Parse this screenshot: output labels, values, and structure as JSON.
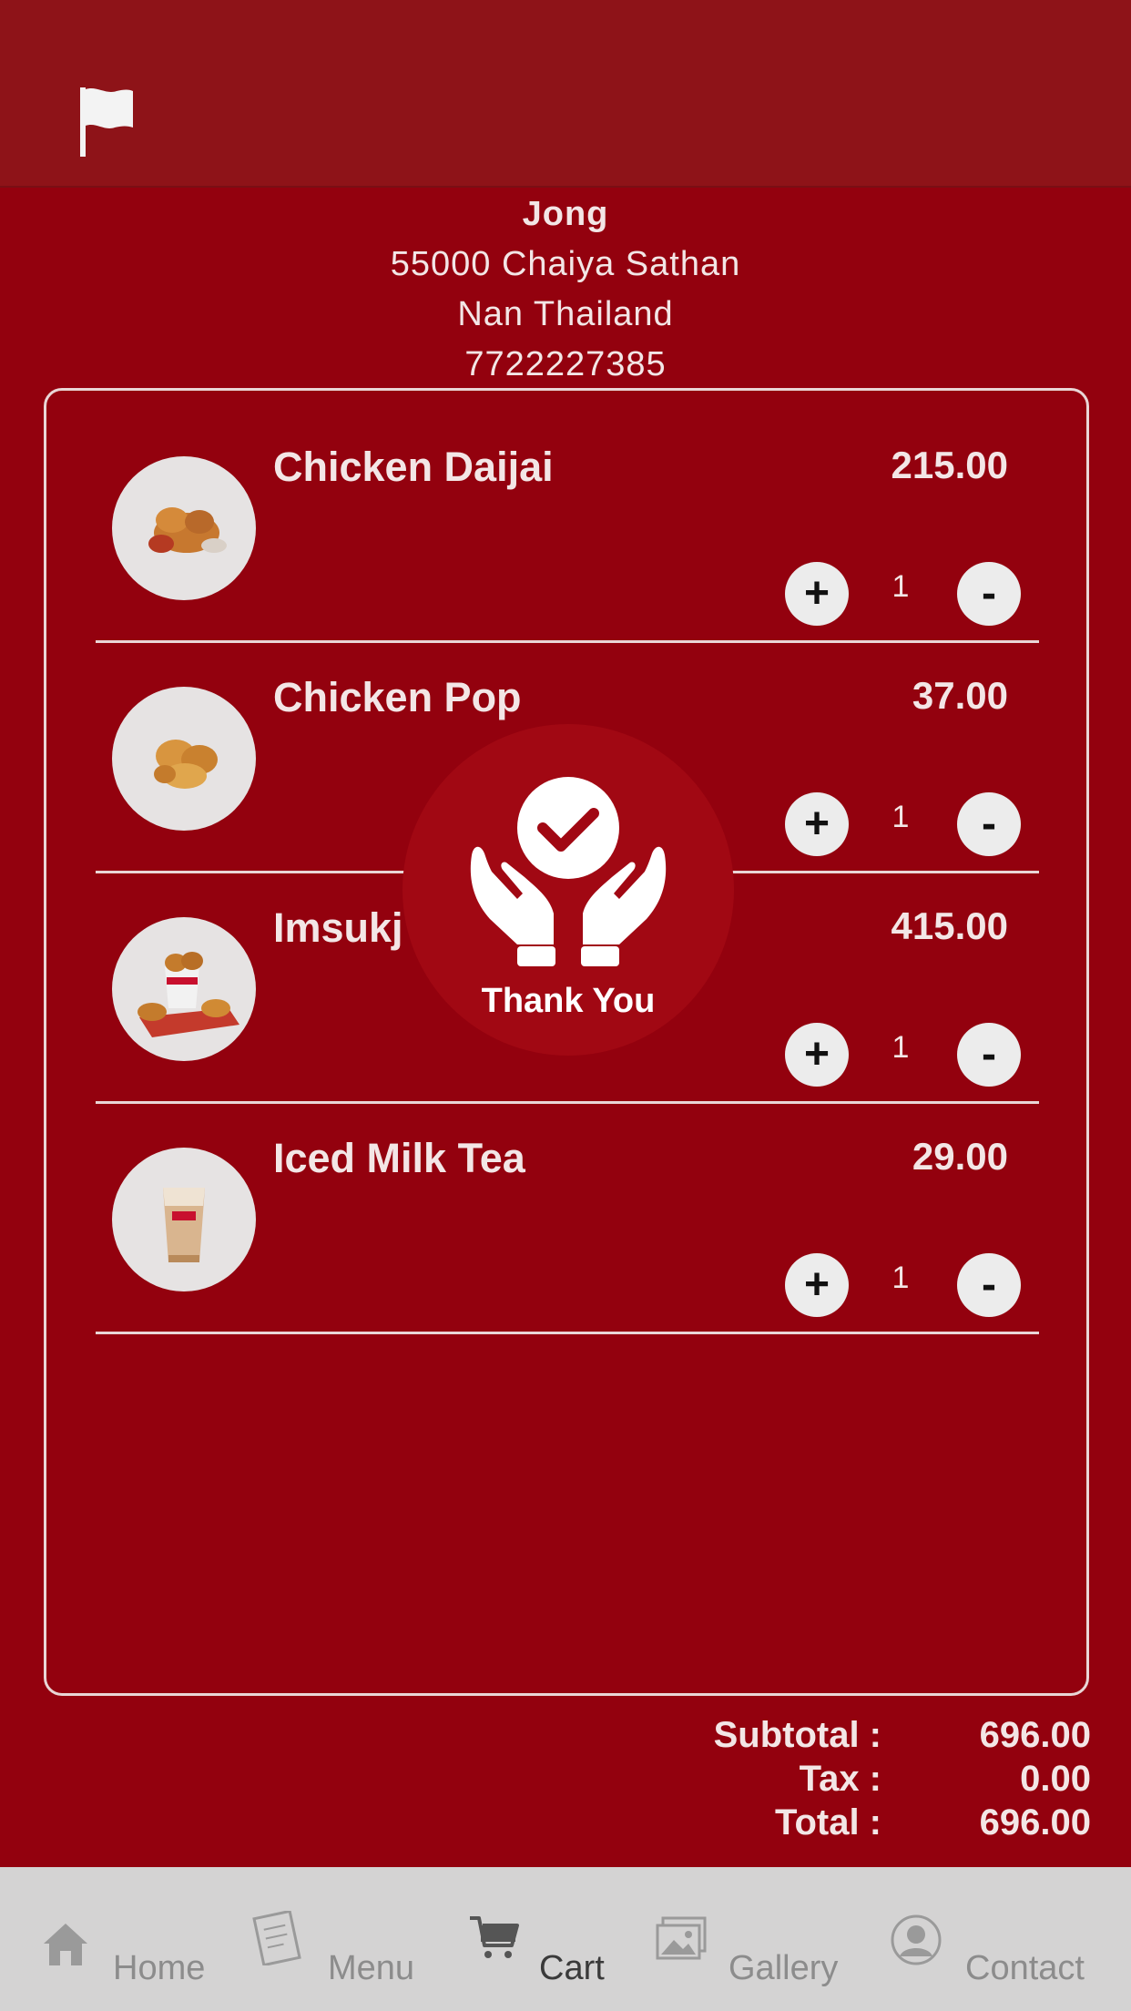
{
  "header": {
    "flag_icon": "flag-icon"
  },
  "customer": {
    "name": "Jong",
    "address_line1": "55000 Chaiya Sathan",
    "address_line2": "Nan Thailand",
    "phone": "7722227385"
  },
  "cart": {
    "items": [
      {
        "name": "Chicken Daijai",
        "price": "215.00",
        "quantity": "1",
        "plus": "+",
        "minus": "-"
      },
      {
        "name": "Chicken Pop",
        "price": "37.00",
        "quantity": "1",
        "plus": "+",
        "minus": "-"
      },
      {
        "name": "Imsukj",
        "price": "415.00",
        "quantity": "1",
        "plus": "+",
        "minus": "-"
      },
      {
        "name": "Iced Milk Tea",
        "price": "29.00",
        "quantity": "1",
        "plus": "+",
        "minus": "-"
      }
    ]
  },
  "overlay": {
    "text": "Thank You",
    "icon": "hands-check-icon"
  },
  "totals": {
    "subtotal_label": "Subtotal :",
    "subtotal_value": "696.00",
    "tax_label": "Tax :",
    "tax_value": "0.00",
    "total_label": "Total :",
    "total_value": "696.00"
  },
  "tabbar": {
    "tabs": [
      {
        "label": "Home",
        "icon": "home-icon"
      },
      {
        "label": "Menu",
        "icon": "menu-icon"
      },
      {
        "label": "Cart",
        "icon": "cart-icon",
        "active": true
      },
      {
        "label": "Gallery",
        "icon": "gallery-icon"
      },
      {
        "label": "Contact",
        "icon": "contact-icon"
      }
    ]
  },
  "colors": {
    "background": "#93010e",
    "header": "#8e1318",
    "tabbar": "#d4d3d3",
    "overlay": "#a10813"
  }
}
